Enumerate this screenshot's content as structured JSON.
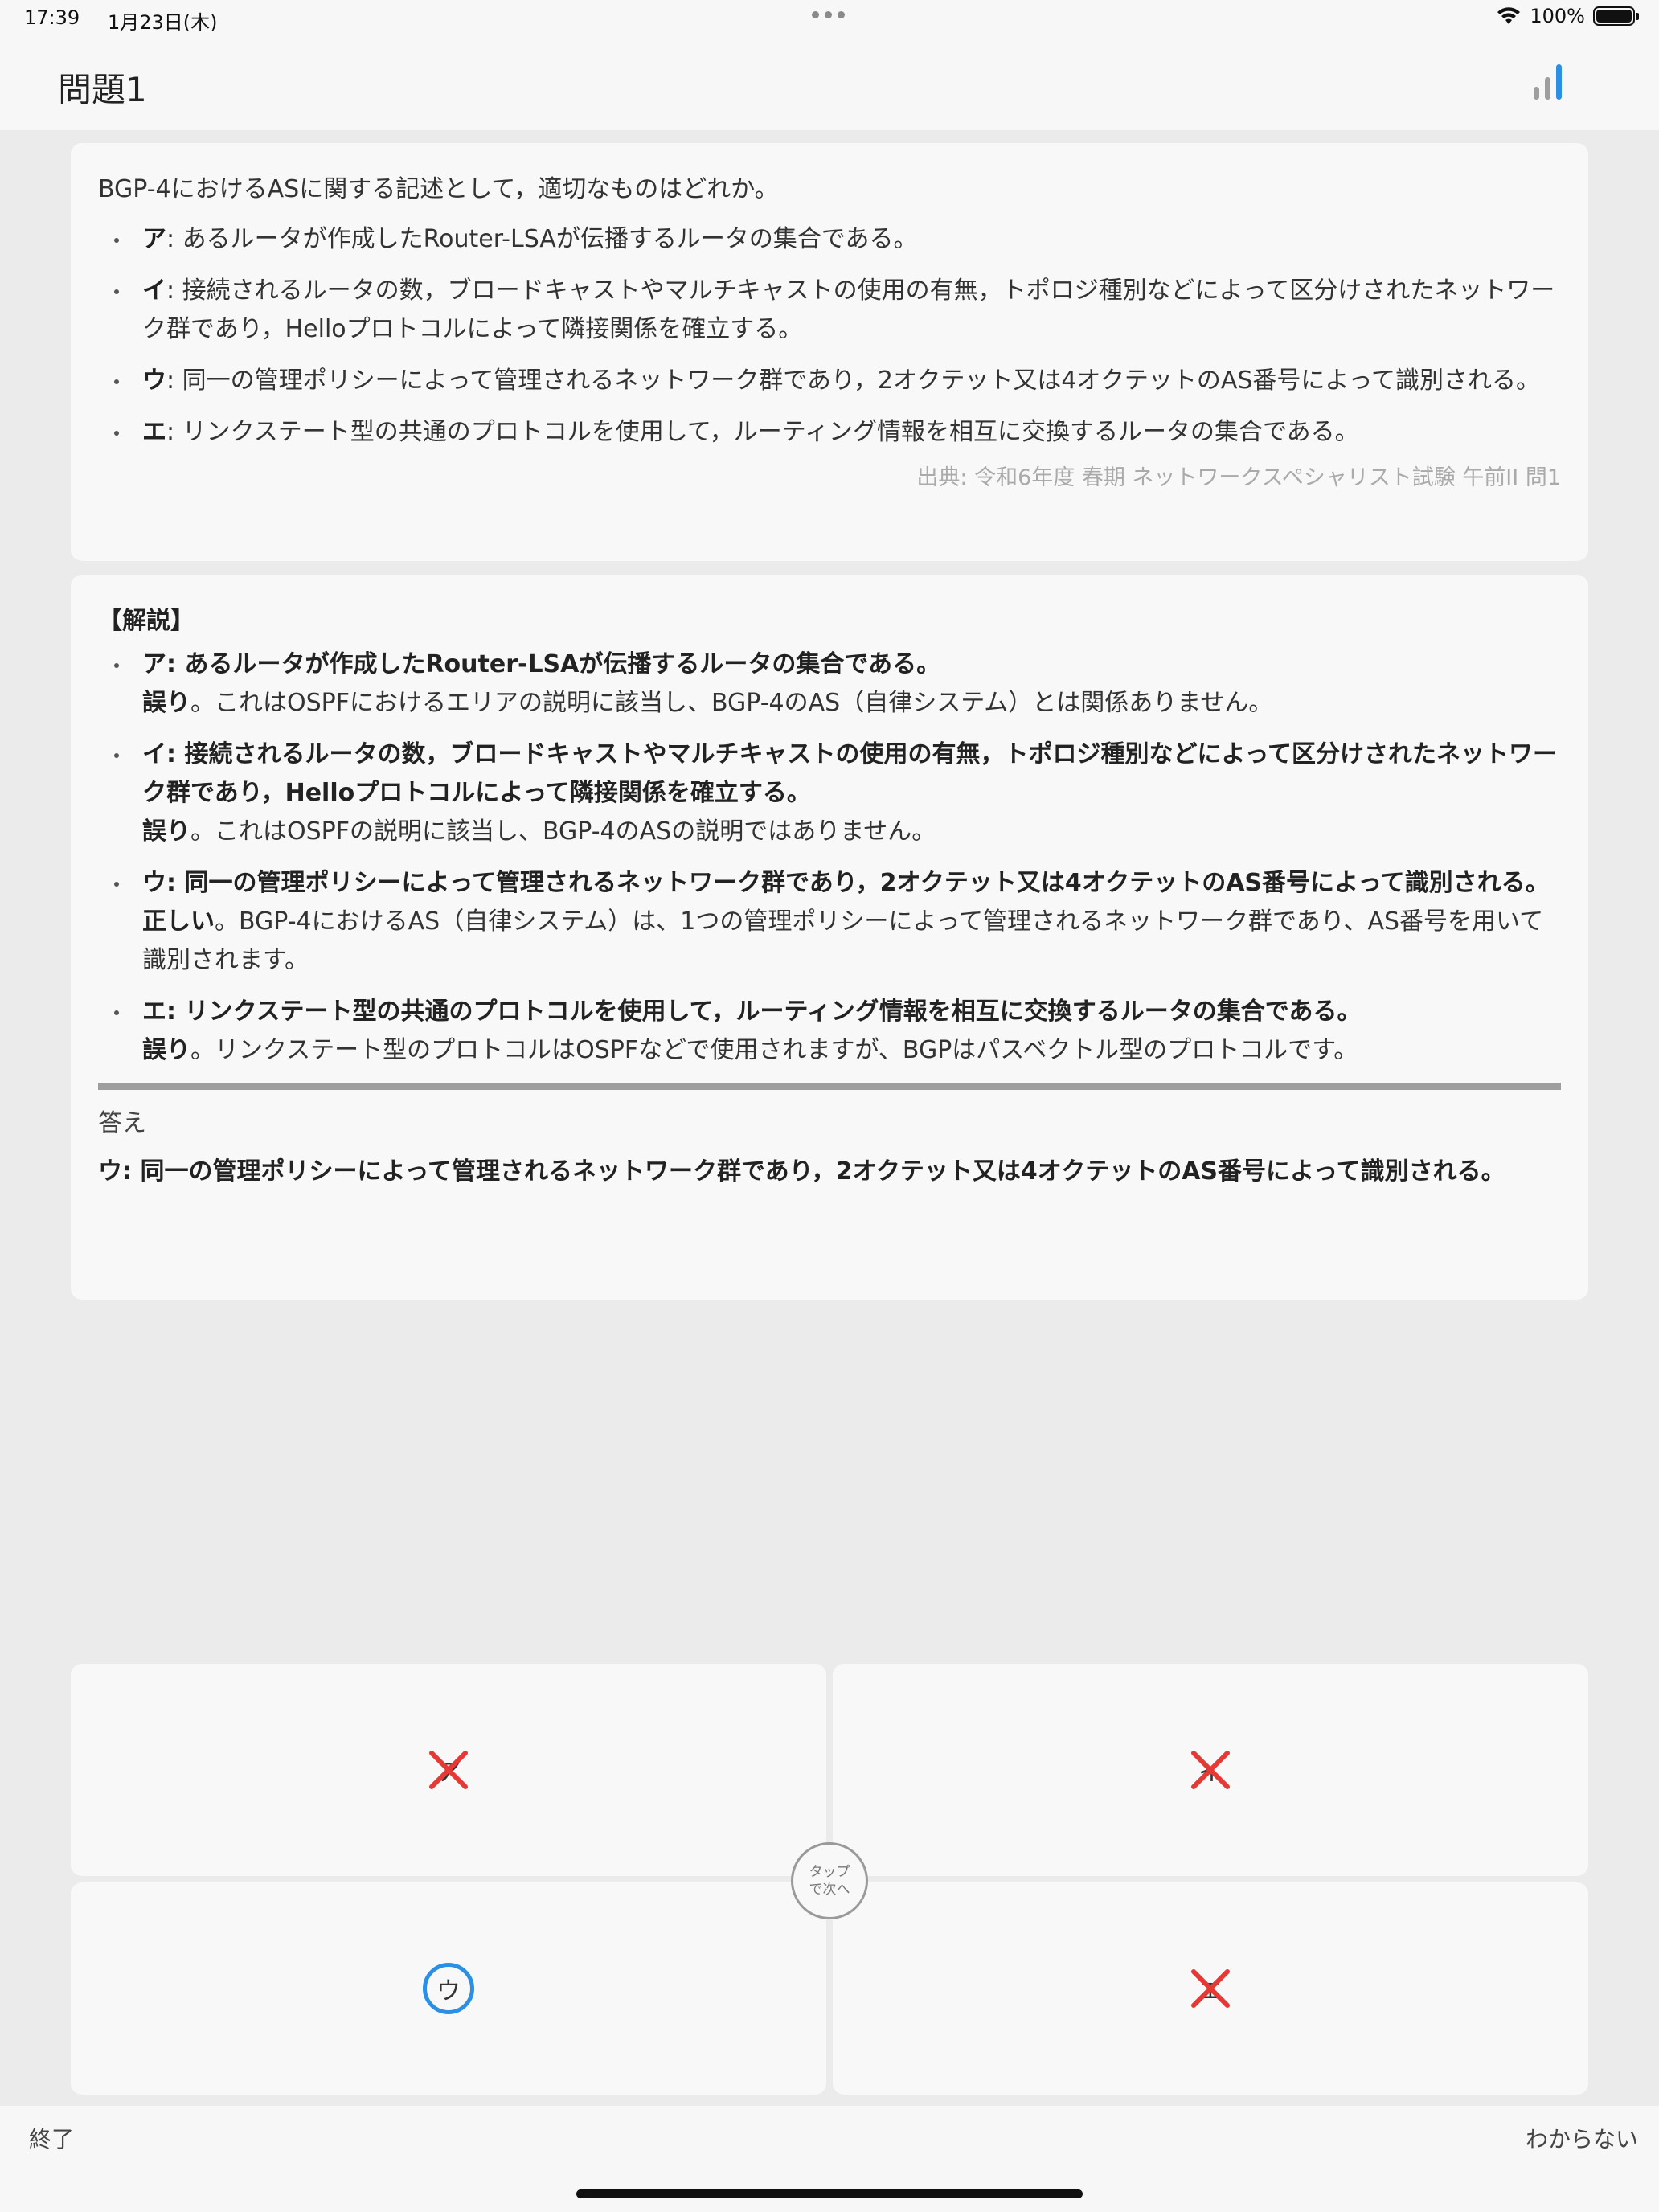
{
  "status_bar": {
    "time": "17:39",
    "date": "1月23日(木)",
    "battery": "100%"
  },
  "header": {
    "title": "問題1",
    "stats_icon": "bar-chart-icon",
    "accent_color": "#2b8fe6"
  },
  "question": {
    "prompt": "BGP-4におけるASに関する記述として，適切なものはどれか。",
    "options": [
      {
        "key": "ア",
        "sep": ": ",
        "text": "あるルータが作成したRouter-LSAが伝播するルータの集合である。"
      },
      {
        "key": "イ",
        "sep": ": ",
        "text": "接続されるルータの数，ブロードキャストやマルチキャストの使用の有無，トポロジ種別などによって区分けされたネットワーク群であり，Helloプロトコルによって隣接関係を確立する。"
      },
      {
        "key": "ウ",
        "sep": ": ",
        "text": "同一の管理ポリシーによって管理されるネットワーク群であり，2オクテット又は4オクテットのAS番号によって識別される。"
      },
      {
        "key": "エ",
        "sep": ": ",
        "text": "リンクステート型の共通のプロトコルを使用して，ルーティング情報を相互に交換するルータの集合である。"
      }
    ],
    "source": "出典: 令和6年度 春期 ネットワークスペシャリスト試験 午前II 問1"
  },
  "explanation": {
    "heading": "【解説】",
    "items": [
      {
        "title": "ア: あるルータが作成したRouter-LSAが伝播するルータの集合である。",
        "verdict": "誤り",
        "detail": "。これはOSPFにおけるエリアの説明に該当し、BGP-4のAS（自律システム）とは関係ありません。"
      },
      {
        "title": "イ: 接続されるルータの数，ブロードキャストやマルチキャストの使用の有無，トポロジ種別などによって区分けされたネットワーク群であり，Helloプロトコルによって隣接関係を確立する。",
        "verdict": "誤り",
        "detail": "。これはOSPFの説明に該当し、BGP-4のASの説明ではありません。"
      },
      {
        "title": "ウ: 同一の管理ポリシーによって管理されるネットワーク群であり，2オクテット又は4オクテットのAS番号によって識別される。",
        "verdict": "正しい",
        "detail": "。BGP-4におけるAS（自律システム）は、1つの管理ポリシーによって管理されるネットワーク群であり、AS番号を用いて識別されます。"
      },
      {
        "title": "エ: リンクステート型の共通のプロトコルを使用して，ルーティング情報を相互に交換するルータの集合である。",
        "verdict": "誤り",
        "detail": "。リンクステート型のプロトコルはOSPFなどで使用されますが、BGPはパスベクトル型のプロトコルです。"
      }
    ],
    "answer_label": "答え",
    "answer_text": "ウ: 同一の管理ポリシーによって管理されるネットワーク群であり，2オクテット又は4オクテットのAS番号によって識別される。"
  },
  "choices": [
    {
      "label": "ア",
      "result": "wrong",
      "icon": "cross-mark-icon"
    },
    {
      "label": "イ",
      "result": "wrong",
      "icon": "cross-mark-icon"
    },
    {
      "label": "ウ",
      "result": "correct",
      "icon": "circle-mark-icon"
    },
    {
      "label": "エ",
      "result": "wrong",
      "icon": "cross-mark-icon"
    }
  ],
  "next_button": {
    "line1": "タップ",
    "line2": "で次へ"
  },
  "footer": {
    "end_label": "終了",
    "unknown_label": "わからない"
  },
  "colors": {
    "wrong": "#e53935",
    "correct": "#2b8fe6",
    "background": "#ebebeb",
    "card": "#f8f8f8"
  }
}
